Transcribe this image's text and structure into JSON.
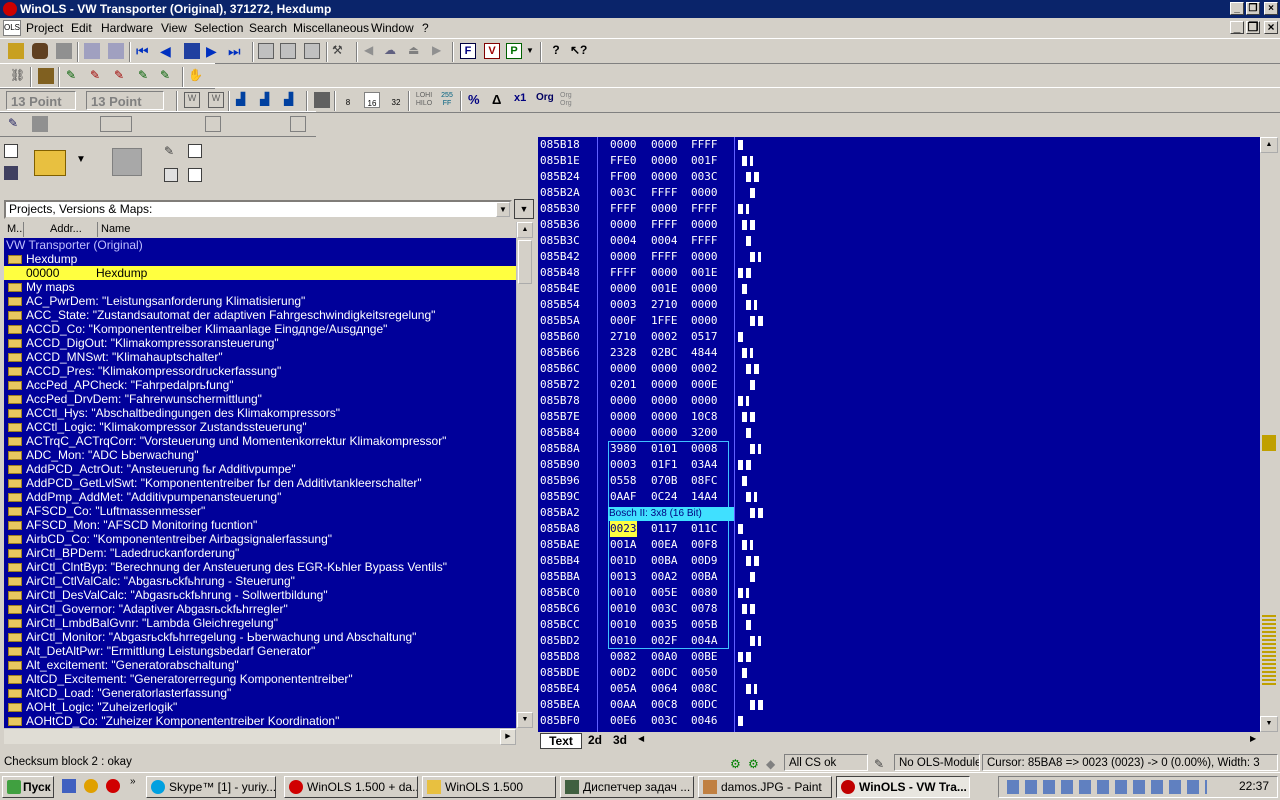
{
  "window": {
    "title": "WinOLS - VW Transporter (Original), 371272, Hexdump"
  },
  "menu": [
    "Project",
    "Edit",
    "Hardware",
    "View",
    "Selection",
    "Search",
    "Miscellaneous",
    "Window",
    "?"
  ],
  "toolbar": {
    "point_size_1": "13 Point",
    "point_size_2": "13 Point",
    "lohi_label": "LOHI HILO",
    "ff_label": "255 FF",
    "pct_label": "%",
    "delta_label": "Δ",
    "x1_label": "x1",
    "org_label": "Org",
    "org2_label": "Org Org",
    "bits": [
      "8",
      "16",
      "32"
    ]
  },
  "project_combo": {
    "value": "Projects, Versions & Maps:"
  },
  "list_headers": {
    "m": "M..",
    "addr": "Addr...",
    "name": "Name"
  },
  "tree": {
    "root": "VW Transporter (Original)",
    "hexdump_folder": "Hexdump",
    "selected": {
      "addr": "00000",
      "name": "Hexdump"
    },
    "mymaps": "My maps",
    "items": [
      "AC_PwrDem: \"Leistungsanforderung Klimatisierung\"",
      "ACC_State: \"Zustandsautomat der adaptiven Fahrgeschwindigkeitsregelung\"",
      "ACCD_Co: \"Komponententreiber Klimaanlage Eingдnge/Ausgдnge\"",
      "ACCD_DigOut: \"Klimakompressoransteuerung\"",
      "ACCD_MNSwt: \"Klimahauptschalter\"",
      "ACCD_Pres: \"Klimakompressordruckerfassung\"",
      "AccPed_APCheck: \"Fahrpedalprьfung\"",
      "AccPed_DrvDem: \"Fahrerwunschermittlung\"",
      "ACCtl_Hys: \"Abschaltbedingungen des Klimakompressors\"",
      "ACCtl_Logic: \"Klimakompressor Zustandssteuerung\"",
      "ACTrqC_ACTrqCorr: \"Vorsteuerung und Momentenkorrektur Klimakompressor\"",
      "ADC_Mon: \"ADC Ьberwachung\"",
      "AddPCD_ActrOut: \"Ansteuerung fьr Additivpumpe\"",
      "AddPCD_GetLvlSwt: \"Komponententreiber fьr den Additivtankleerschalter\"",
      "AddPmp_AddMet: \"Additivpumpenansteuerung\"",
      "AFSCD_Co: \"Luftmassenmesser\"",
      "AFSCD_Mon: \"AFSCD Monitoring fucntion\"",
      "AirbCD_Co: \"Komponententreiber Airbagsignalerfassung\"",
      "AirCtl_BPDem: \"Ladedruckanforderung\"",
      "AirCtl_ClntByp: \"Berechnung der Ansteuerung des EGR-Kьhler Bypass Ventils\"",
      "AirCtl_CtlValCalc: \"Abgasrьckfьhrung - Steuerung\"",
      "AirCtl_DesValCalc: \"Abgasrьckfьhrung - Sollwertbildung\"",
      "AirCtl_Governor: \"Adaptiver Abgasrьckfьhrregler\"",
      "AirCtl_LmbdBalGvnr: \"Lambda Gleichregelung\"",
      "AirCtl_Monitor: \"Abgasrьckfьhrregelung - Ьberwachung und Abschaltung\"",
      "Alt_DetAltPwr: \"Ermittlung Leistungsbedarf Generator\"",
      "Alt_excitement: \"Generatorabschaltung\"",
      "AltCD_Excitement: \"Generatorerregung Komponententreiber\"",
      "AltCD_Load: \"Generatorlasterfassung\"",
      "AOHt_Logic: \"Zuheizerlogik\"",
      "AOHtCD_Co: \"Zuheizer Komponententreiber Koordination\""
    ]
  },
  "hex": {
    "rows": [
      {
        "addr": "085B18",
        "v": [
          "0000",
          "0000",
          "FFFF"
        ]
      },
      {
        "addr": "085B1E",
        "v": [
          "FFE0",
          "0000",
          "001F"
        ]
      },
      {
        "addr": "085B24",
        "v": [
          "FF00",
          "0000",
          "003C"
        ]
      },
      {
        "addr": "085B2A",
        "v": [
          "003C",
          "FFFF",
          "0000"
        ]
      },
      {
        "addr": "085B30",
        "v": [
          "FFFF",
          "0000",
          "FFFF"
        ]
      },
      {
        "addr": "085B36",
        "v": [
          "0000",
          "FFFF",
          "0000"
        ]
      },
      {
        "addr": "085B3C",
        "v": [
          "0004",
          "0004",
          "FFFF"
        ]
      },
      {
        "addr": "085B42",
        "v": [
          "0000",
          "FFFF",
          "0000"
        ]
      },
      {
        "addr": "085B48",
        "v": [
          "FFFF",
          "0000",
          "001E"
        ]
      },
      {
        "addr": "085B4E",
        "v": [
          "0000",
          "001E",
          "0000"
        ]
      },
      {
        "addr": "085B54",
        "v": [
          "0003",
          "2710",
          "0000"
        ]
      },
      {
        "addr": "085B5A",
        "v": [
          "000F",
          "1FFE",
          "0000"
        ]
      },
      {
        "addr": "085B60",
        "v": [
          "2710",
          "0002",
          "0517"
        ]
      },
      {
        "addr": "085B66",
        "v": [
          "2328",
          "02BC",
          "4844"
        ]
      },
      {
        "addr": "085B6C",
        "v": [
          "0000",
          "0000",
          "0002"
        ]
      },
      {
        "addr": "085B72",
        "v": [
          "0201",
          "0000",
          "000E"
        ]
      },
      {
        "addr": "085B78",
        "v": [
          "0000",
          "0000",
          "0000"
        ]
      },
      {
        "addr": "085B7E",
        "v": [
          "0000",
          "0000",
          "10C8"
        ]
      },
      {
        "addr": "085B84",
        "v": [
          "0000",
          "0000",
          "3200"
        ]
      },
      {
        "addr": "085B8A",
        "v": [
          "3980",
          "0101",
          "0008"
        ]
      },
      {
        "addr": "085B90",
        "v": [
          "0003",
          "01F1",
          "03A4"
        ]
      },
      {
        "addr": "085B96",
        "v": [
          "0558",
          "070B",
          "08FC"
        ]
      },
      {
        "addr": "085B9C",
        "v": [
          "0AAF",
          "0C24",
          "14A4"
        ]
      },
      {
        "addr": "085BA2",
        "v": [
          "",
          "",
          "4"
        ]
      },
      {
        "addr": "085BA8",
        "v": [
          "0023",
          "0117",
          "011C"
        ]
      },
      {
        "addr": "085BAE",
        "v": [
          "001A",
          "00EA",
          "00F8"
        ]
      },
      {
        "addr": "085BB4",
        "v": [
          "001D",
          "00BA",
          "00D9"
        ]
      },
      {
        "addr": "085BBA",
        "v": [
          "0013",
          "00A2",
          "00BA"
        ]
      },
      {
        "addr": "085BC0",
        "v": [
          "0010",
          "005E",
          "0080"
        ]
      },
      {
        "addr": "085BC6",
        "v": [
          "0010",
          "003C",
          "0078"
        ]
      },
      {
        "addr": "085BCC",
        "v": [
          "0010",
          "0035",
          "005B"
        ]
      },
      {
        "addr": "085BD2",
        "v": [
          "0010",
          "002F",
          "004A"
        ]
      },
      {
        "addr": "085BD8",
        "v": [
          "0082",
          "00A0",
          "00BE"
        ]
      },
      {
        "addr": "085BDE",
        "v": [
          "00D2",
          "00DC",
          "0050"
        ]
      },
      {
        "addr": "085BE4",
        "v": [
          "005A",
          "0064",
          "008C"
        ]
      },
      {
        "addr": "085BEA",
        "v": [
          "00AA",
          "00C8",
          "00DC"
        ]
      },
      {
        "addr": "085BF0",
        "v": [
          "00E6",
          "003C",
          "0046"
        ]
      }
    ],
    "map_label": "Bosch II: 3x8 (16 Bit)"
  },
  "tabs": [
    "Text",
    "2d",
    "3d"
  ],
  "status": {
    "left": "Checksum block 2 : okay",
    "cs": "All CS ok",
    "ols": "No OLS-Module",
    "cursor": "Cursor: 85BA8 => 0023 (0023) -> 0 (0.00%), Width: 3"
  },
  "taskbar": {
    "start": "Пуск",
    "tasks": [
      "Skype™ [1] - yuriy...",
      "WinOLS 1.500 + da...",
      "WinOLS 1.500",
      "Диспетчер задач ...",
      "damos.JPG - Paint",
      "WinOLS - VW Tra..."
    ],
    "clock": "22:37"
  },
  "colors": {
    "titlebar": "#0a246a",
    "hexbg": "#00009a",
    "highlight": "#ffff40",
    "map_border": "#40c0ff"
  }
}
